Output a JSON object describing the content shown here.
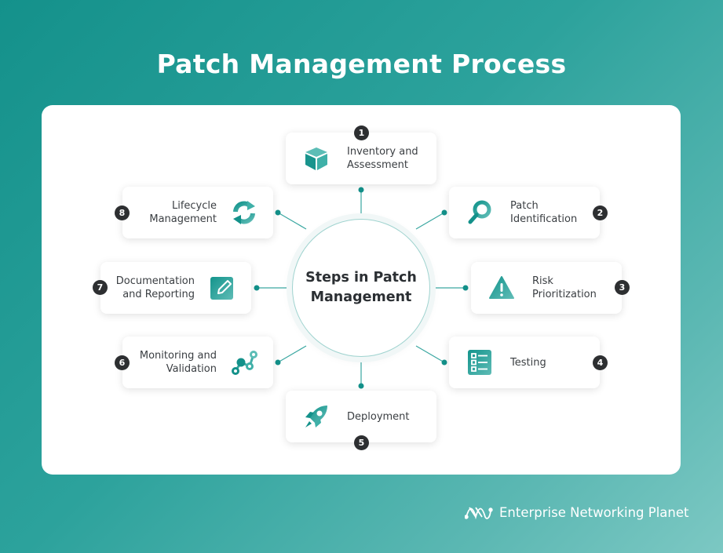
{
  "title": "Patch Management Process",
  "hub": {
    "label": "Steps in Patch\nManagement"
  },
  "colors": {
    "accent": "#1e9a93",
    "badge": "#2d2f31",
    "line": "#3aa7a1"
  },
  "steps": [
    {
      "number": "1",
      "label": "Inventory and\nAssessment",
      "icon": "cube-icon"
    },
    {
      "number": "2",
      "label": "Patch\nIdentification",
      "icon": "magnifier-icon"
    },
    {
      "number": "3",
      "label": "Risk\nPrioritization",
      "icon": "warning-icon"
    },
    {
      "number": "4",
      "label": "Testing",
      "icon": "checklist-icon"
    },
    {
      "number": "5",
      "label": "Deployment",
      "icon": "rocket-icon"
    },
    {
      "number": "6",
      "label": "Monitoring and\nValidation",
      "icon": "graph-nodes-icon"
    },
    {
      "number": "7",
      "label": "Documentation\nand Reporting",
      "icon": "edit-icon"
    },
    {
      "number": "8",
      "label": "Lifecycle\nManagement",
      "icon": "refresh-icon"
    }
  ],
  "brand": {
    "name": "Enterprise Networking Planet",
    "icon": "network-logo-icon"
  }
}
